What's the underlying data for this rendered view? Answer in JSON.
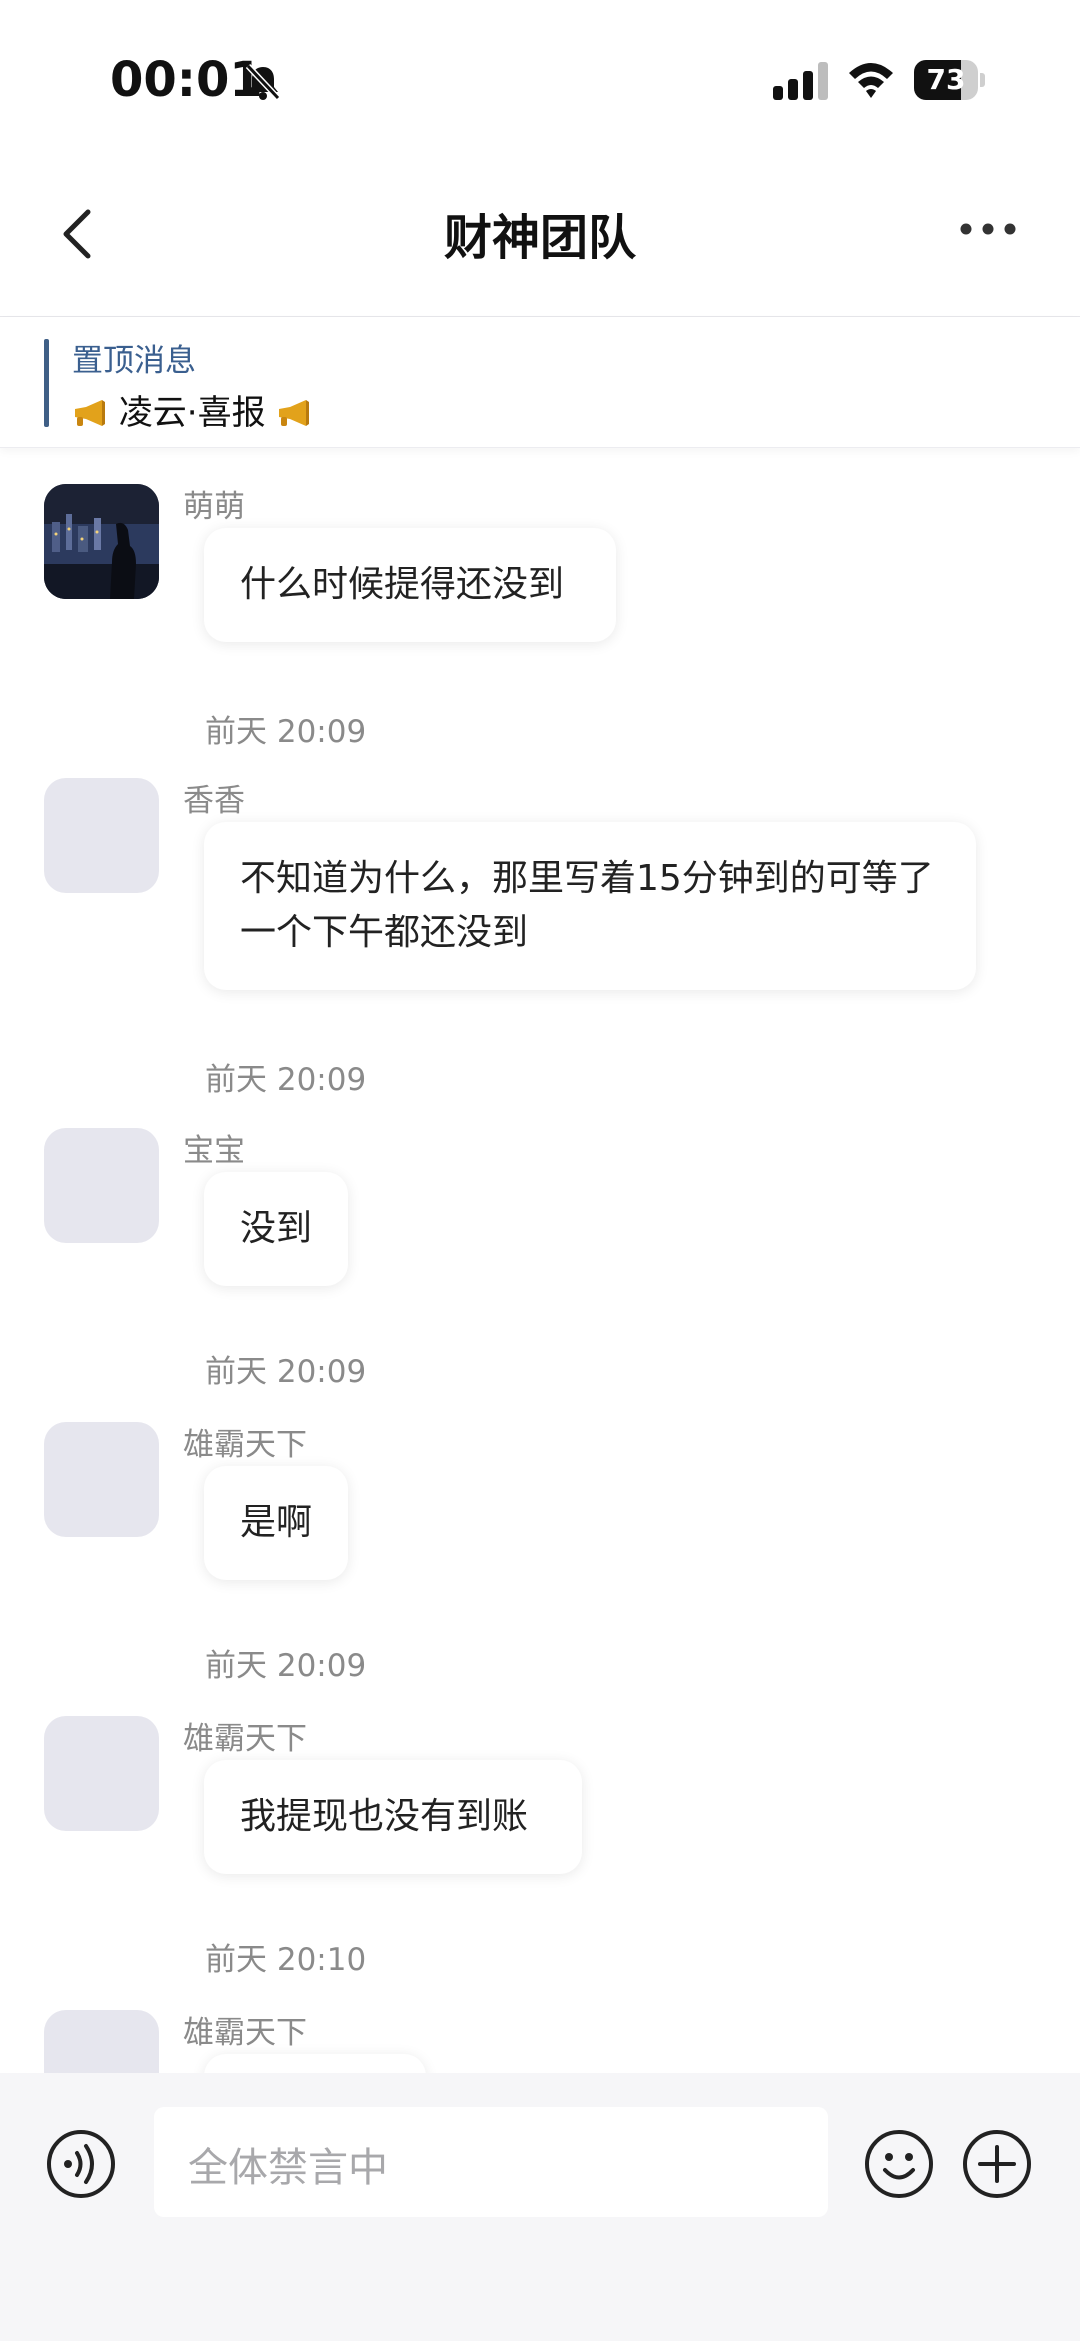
{
  "status_bar": {
    "time": "00:01",
    "battery_level": "73",
    "battery_fraction": 0.73
  },
  "header": {
    "title": "财神团队"
  },
  "pinned": {
    "label": "置顶消息",
    "content": "凌云·喜报"
  },
  "messages": [
    {
      "sender": "萌萌",
      "text": "什么时候提得还没到",
      "time": "前天 20:09",
      "has_photo_avatar": true
    },
    {
      "sender": "香香",
      "text": "不知道为什么，那里写着15分钟到的可等了一个下午都还没到",
      "time": "前天 20:09"
    },
    {
      "sender": "宝宝",
      "text": "没到",
      "time": "前天 20:09"
    },
    {
      "sender": "雄霸天下",
      "text": "是啊",
      "time": "前天 20:09"
    },
    {
      "sender": "雄霸天下",
      "text": "我提现也没有到账",
      "time": "前天 20:10"
    },
    {
      "sender": "雄霸天下",
      "text": "",
      "time": ""
    }
  ],
  "input": {
    "placeholder": "全体禁言中"
  },
  "icons": {
    "bell": "bell-muted-icon",
    "signal": "cellular-signal-icon",
    "wifi": "wifi-icon",
    "back": "chevron-left-icon",
    "more": "more-dots-icon",
    "voice": "voice-icon",
    "emoji": "emoji-icon",
    "plus": "plus-icon",
    "megaphone": "megaphone-icon"
  },
  "colors": {
    "accent": "#3a5f8f",
    "background": "#ffffff",
    "bottom_bar": "#f6f6f8"
  }
}
